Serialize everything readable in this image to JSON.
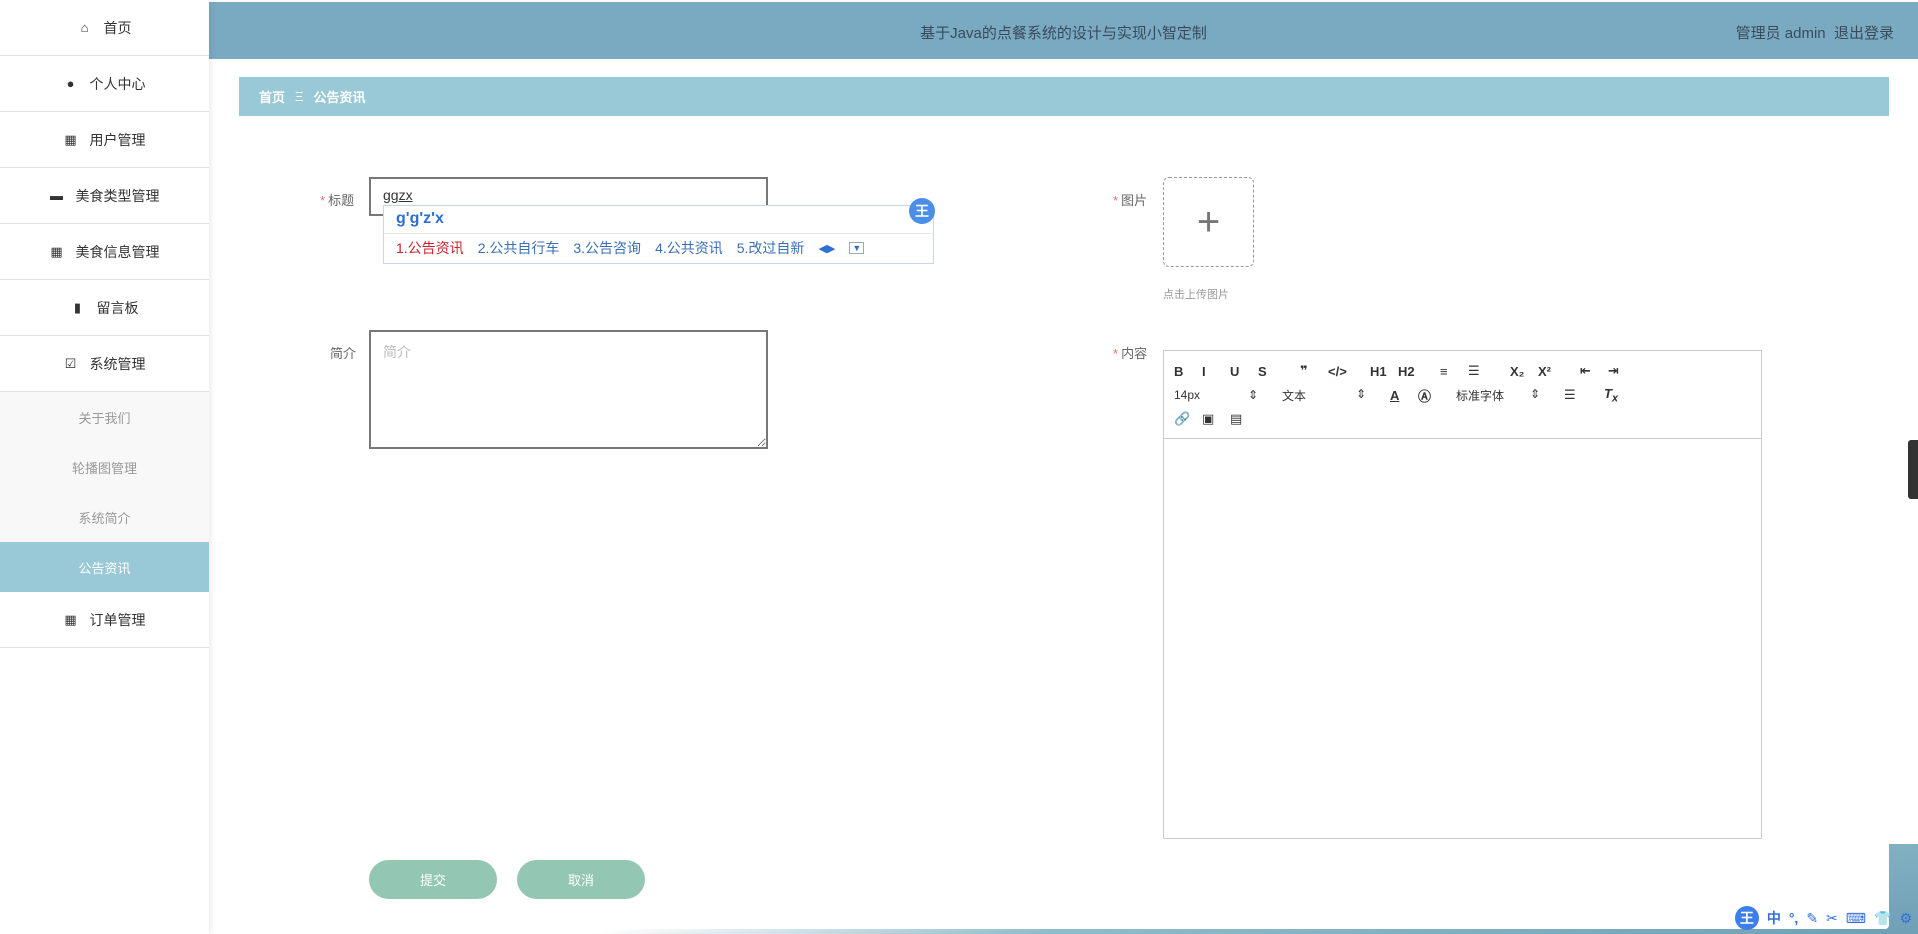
{
  "sidebar": {
    "items": [
      {
        "label": "首页",
        "icon": "home-icon"
      },
      {
        "label": "个人中心",
        "icon": "user-icon"
      },
      {
        "label": "用户管理",
        "icon": "grid-icon"
      },
      {
        "label": "美食类型管理",
        "icon": "monitor-icon"
      },
      {
        "label": "美食信息管理",
        "icon": "grid-icon"
      },
      {
        "label": "留言板",
        "icon": "book-icon"
      },
      {
        "label": "系统管理",
        "icon": "clipboard-check-icon"
      }
    ],
    "submenu": [
      "关于我们",
      "轮播图管理",
      "系统简介",
      "公告资讯"
    ],
    "active": "公告资讯",
    "last": {
      "label": "订单管理",
      "icon": "grid-icon"
    }
  },
  "header": {
    "title": "基于Java的点餐系统的设计与实现小智定制",
    "user": "管理员 admin",
    "logout": "退出登录"
  },
  "breadcrumb": {
    "home": "首页",
    "sep": "Ξ",
    "current": "公告资讯"
  },
  "form": {
    "title_label": "标题",
    "title_value": "ggzx",
    "intro_label": "简介",
    "intro_placeholder": "简介",
    "image_label": "图片",
    "upload_hint": "点击上传图片",
    "content_label": "内容",
    "submit": "提交",
    "cancel": "取消"
  },
  "ime": {
    "pinyin": "g'g'z'x",
    "candidates": [
      "1.公告资讯",
      "2.公共自行车",
      "3.公告咨询",
      "4.公共资讯",
      "5.改过自新"
    ],
    "badge": "王"
  },
  "editor": {
    "row1": [
      "B",
      "I",
      "U",
      "S",
      "❞",
      "</>",
      "H1",
      "H2",
      "≡",
      "☰",
      "X₂",
      "X²",
      "⇤",
      "⇥"
    ],
    "font_size": "14px",
    "block": "文本",
    "font_family": "标准字体"
  },
  "tray": {
    "badge": "王",
    "mode": "中",
    "items": [
      "°,",
      "✎",
      "✂",
      "⌨",
      "👕",
      "⚙"
    ]
  },
  "colors": {
    "header": "#7aaac2",
    "accent": "#99c8d6",
    "button": "#94c6b4",
    "required": "#f56c6c"
  }
}
